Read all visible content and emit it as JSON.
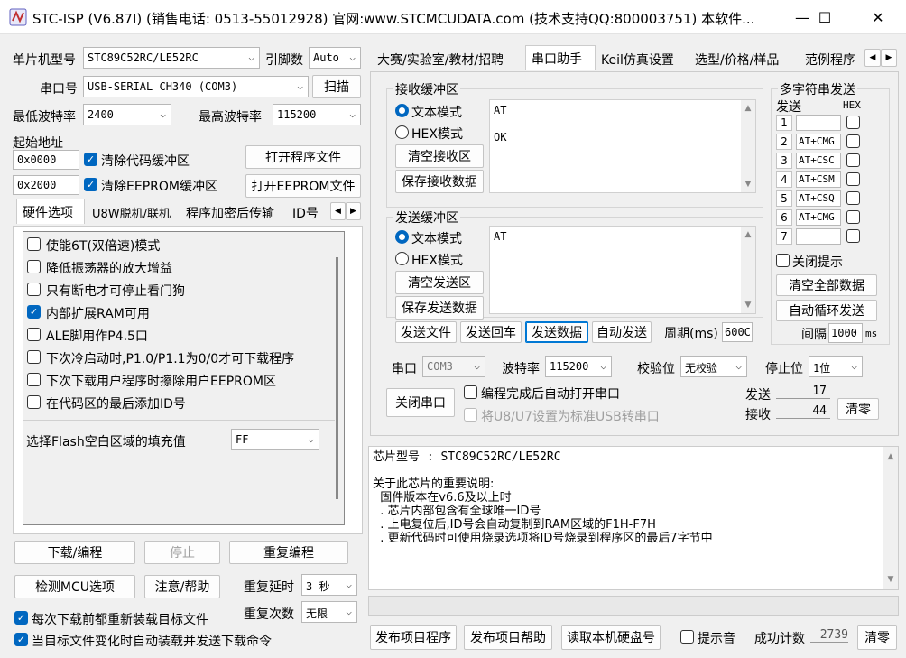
{
  "window": {
    "title": "STC-ISP (V6.87I) (销售电话: 0513-55012928) 官网:www.STCMCUDATA.com  (技术支持QQ:800003751) 本软件...",
    "minimize": "—",
    "maximize": "☐",
    "close": "✕"
  },
  "left": {
    "mcu_label": "单片机型号",
    "mcu_value": "STC89C52RC/LE52RC",
    "pins_label": "引脚数",
    "pins_value": "Auto",
    "port_label": "串口号",
    "port_value": "USB-SERIAL CH340 (COM3)",
    "scan_button": "扫描",
    "min_baud_label": "最低波特率",
    "min_baud_value": "2400",
    "max_baud_label": "最高波特率",
    "max_baud_value": "115200",
    "start_addr_label": "起始地址",
    "addr1": "0x0000",
    "clear_code_label": "清除代码缓冲区",
    "open_prog_button": "打开程序文件",
    "addr2": "0x2000",
    "clear_eeprom_label": "清除EEPROM缓冲区",
    "open_eeprom_button": "打开EEPROM文件",
    "tabs": [
      "硬件选项",
      "U8W脱机/联机",
      "程序加密后传输",
      "ID号"
    ],
    "options": [
      {
        "label": "使能6T(双倍速)模式",
        "checked": false
      },
      {
        "label": "降低振荡器的放大增益",
        "checked": false
      },
      {
        "label": "只有断电才可停止看门狗",
        "checked": false
      },
      {
        "label": "内部扩展RAM可用",
        "checked": true
      },
      {
        "label": "ALE脚用作P4.5口",
        "checked": false
      },
      {
        "label": "下次冷启动时,P1.0/P1.1为0/0才可下载程序",
        "checked": false
      },
      {
        "label": "下次下载用户程序时擦除用户EEPROM区",
        "checked": false
      },
      {
        "label": "在代码区的最后添加ID号",
        "checked": false
      }
    ],
    "fill_label": "选择Flash空白区域的填充值",
    "fill_value": "FF",
    "download_button": "下载/编程",
    "stop_button": "停止",
    "reprogram_button": "重复编程",
    "detect_button": "检测MCU选项",
    "help_button": "注意/帮助",
    "repeat_delay_label": "重复延时",
    "repeat_delay_value": "3 秒",
    "repeat_count_label": "重复次数",
    "repeat_count_value": "无限",
    "reload_label": "每次下载前都重新装载目标文件",
    "autoload_label": "当目标文件变化时自动装载并发送下载命令"
  },
  "right": {
    "tabs": [
      "大赛/实验室/教材/招聘",
      "串口助手",
      "Keil仿真设置",
      "选型/价格/样品",
      "范例程序"
    ],
    "active_tab": "串口助手",
    "recv_group": "接收缓冲区",
    "text_mode": "文本模式",
    "hex_mode": "HEX模式",
    "clear_recv_button": "清空接收区",
    "save_recv_button": "保存接收数据",
    "recv_lines": [
      "AT",
      "",
      "OK"
    ],
    "send_group": "发送缓冲区",
    "clear_send_button": "清空发送区",
    "save_send_button": "保存发送数据",
    "send_text": "AT",
    "send_file_button": "发送文件",
    "send_return_button": "发送回车",
    "send_data_button": "发送数据",
    "auto_send_button": "自动发送",
    "period_label": "周期(ms)",
    "period_value": "600C",
    "multi_title": "多字符串发送",
    "send_col": "发送",
    "hex_col": "HEX",
    "multi_rows": [
      {
        "num": "1",
        "text": ""
      },
      {
        "num": "2",
        "text": "AT+CMG"
      },
      {
        "num": "3",
        "text": "AT+CSC"
      },
      {
        "num": "4",
        "text": "AT+CSM"
      },
      {
        "num": "5",
        "text": "AT+CSQ"
      },
      {
        "num": "6",
        "text": "AT+CMG"
      },
      {
        "num": "7",
        "text": ""
      }
    ],
    "close_hint_label": "关闭提示",
    "clear_all_button": "清空全部数据",
    "auto_loop_button": "自动循环发送",
    "interval_label": "间隔",
    "interval_value": "1000",
    "interval_unit": "ms",
    "port_label": "串口",
    "port_value": "COM3",
    "baud_label": "波特率",
    "baud_value": "115200",
    "parity_label": "校验位",
    "parity_value": "无校验",
    "stop_label": "停止位",
    "stop_value": "1位",
    "close_port_button": "关闭串口",
    "auto_open_label": "编程完成后自动打开串口",
    "usb_label": "将U8/U7设置为标准USB转串口",
    "send_count_label": "发送",
    "send_count": "17",
    "recv_count_label": "接收",
    "recv_count": "44",
    "clear_counts_button": "清零",
    "info_lines": [
      "芯片型号 : STC89C52RC/LE52RC",
      "",
      "关于此芯片的重要说明:",
      "  固件版本在v6.6及以上时",
      "  . 芯片内部包含有全球唯一ID号",
      "  . 上电复位后,ID号会自动复制到RAM区域的F1H-F7H",
      "  . 更新代码时可使用烧录选项将ID号烧录到程序区的最后7字节中"
    ],
    "publish_button": "发布项目程序",
    "publish_help_button": "发布项目帮助",
    "read_disk_button": "读取本机硬盘号",
    "sound_label": "提示音",
    "success_label": "成功计数",
    "success_value": "2739",
    "clear_success_button": "清零"
  },
  "colors": {
    "accent": "#0067c0",
    "window_bg": "#f0f0f0",
    "focus": "#0078d4"
  }
}
